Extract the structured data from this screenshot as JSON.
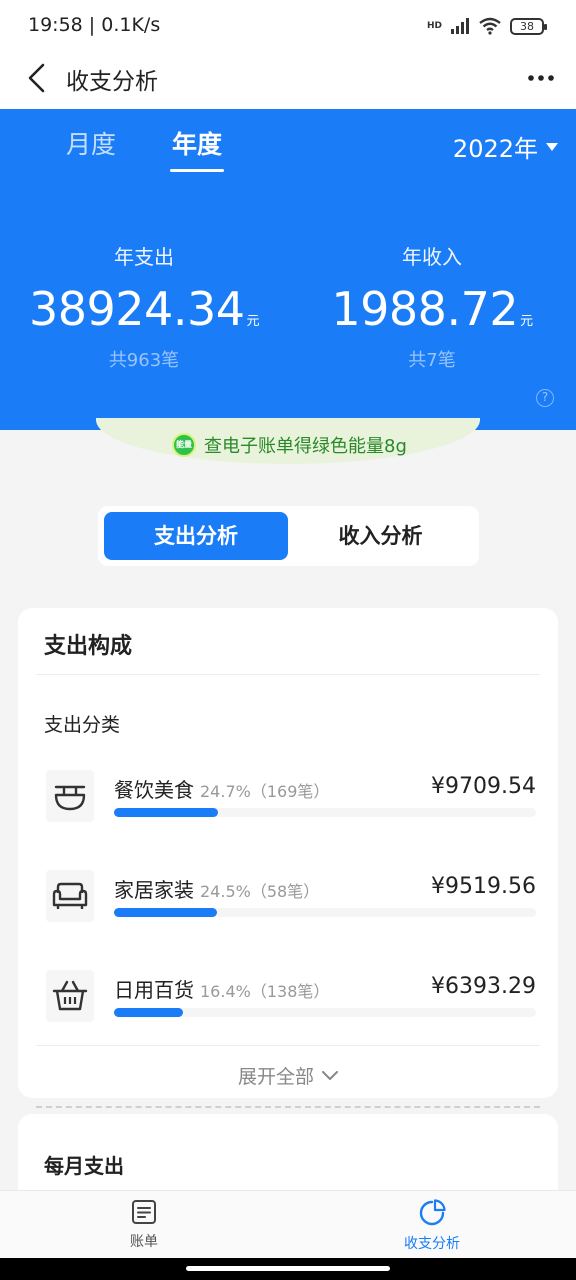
{
  "status_bar": {
    "time": "19:58 | 0.1K/s",
    "battery": "38",
    "network": "HD"
  },
  "header": {
    "title": "收支分析"
  },
  "period_tabs": [
    {
      "label": "月度"
    },
    {
      "label": "年度"
    }
  ],
  "year_selector": {
    "value": "2022年"
  },
  "summary": {
    "expense": {
      "label": "年支出",
      "amount": "38924.34",
      "unit": "元",
      "count": "共963笔"
    },
    "income": {
      "label": "年收入",
      "amount": "1988.72",
      "unit": "元",
      "count": "共7笔"
    },
    "help": "?"
  },
  "banner": {
    "badge": "能量",
    "text": "查电子账单得绿色能量8g"
  },
  "segment": {
    "expense_label": "支出分析",
    "income_label": "收入分析"
  },
  "composition": {
    "title": "支出构成",
    "subtitle": "支出分类",
    "categories": [
      {
        "name": "餐饮美食",
        "meta": "24.7%（169笔）",
        "amount": "¥9709.54",
        "icon": "bowl-icon",
        "share": 0.247
      },
      {
        "name": "家居家装",
        "meta": "24.5%（58笔）",
        "amount": "¥9519.56",
        "icon": "sofa-icon",
        "share": 0.245
      },
      {
        "name": "日用百货",
        "meta": "16.4%（138笔）",
        "amount": "¥6393.29",
        "icon": "basket-icon",
        "share": 0.164
      }
    ],
    "expand_label": "展开全部"
  },
  "monthly": {
    "title": "每月支出"
  },
  "bottom_nav": [
    {
      "label": "账单",
      "icon": "bill-icon"
    },
    {
      "label": "收支分析",
      "icon": "pie-chart-icon"
    }
  ],
  "colors": {
    "primary": "#1a7cf7",
    "banner_bg": "#e9f3dc",
    "banner_text": "#2a8a2a"
  }
}
